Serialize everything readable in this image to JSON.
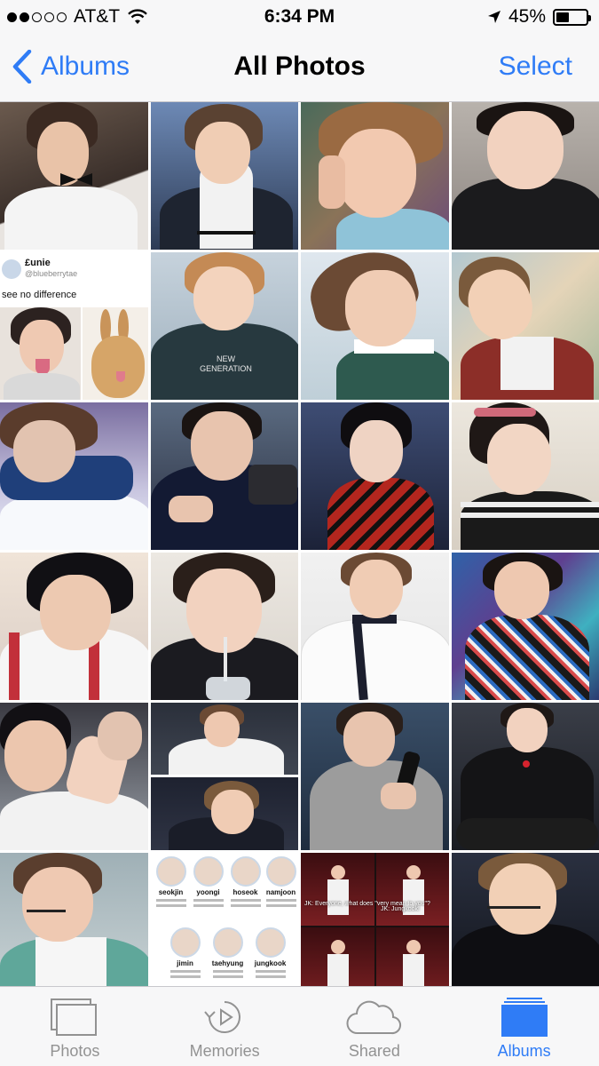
{
  "status_bar": {
    "carrier": "AT&T",
    "time": "6:34 PM",
    "battery_percent": "45%",
    "battery_level": 0.45,
    "signal_bars_filled": 2,
    "signal_bars_total": 5
  },
  "nav": {
    "back_label": "Albums",
    "title": "All Photos",
    "action_label": "Select"
  },
  "photos": [
    {
      "subject": "portrait-bowtie"
    },
    {
      "subject": "portrait-turtleneck"
    },
    {
      "subject": "selfie-closeup"
    },
    {
      "subject": "portrait-smile"
    },
    {
      "subject": "tweet-meme",
      "tweet_name": "£unie",
      "tweet_handle": "@blueberrytae",
      "tweet_text": "see no difference"
    },
    {
      "subject": "portrait-sweater",
      "shirt_text_1": "NEW",
      "shirt_text_2": "GENERATION"
    },
    {
      "subject": "portrait-profile"
    },
    {
      "subject": "portrait-laughing"
    },
    {
      "subject": "portrait-blue"
    },
    {
      "subject": "portrait-camera"
    },
    {
      "subject": "stage-red-jacket"
    },
    {
      "subject": "portrait-headband"
    },
    {
      "subject": "portrait-pink"
    },
    {
      "subject": "portrait-drink"
    },
    {
      "subject": "portrait-choker"
    },
    {
      "subject": "portrait-graffiti"
    },
    {
      "subject": "portrait-wave"
    },
    {
      "subject": "collage-two"
    },
    {
      "subject": "stage-microphone"
    },
    {
      "subject": "portrait-leather"
    },
    {
      "subject": "portrait-headset"
    },
    {
      "subject": "member-chart",
      "names": [
        "seokjin",
        "yoongi",
        "hoseok",
        "namjoon",
        "jimin",
        "taehyung",
        "jungkook"
      ]
    },
    {
      "subject": "stage-collage",
      "caption_1": "JK: Everyone, what does \"very mean to you\"?",
      "caption_2": "JK: Jungkook!"
    },
    {
      "subject": "portrait-dark-headset"
    }
  ],
  "tabs": [
    {
      "label": "Photos",
      "icon": "photos-icon",
      "active": false
    },
    {
      "label": "Memories",
      "icon": "memories-icon",
      "active": false
    },
    {
      "label": "Shared",
      "icon": "cloud-icon",
      "active": false
    },
    {
      "label": "Albums",
      "icon": "albums-icon",
      "active": true
    }
  ],
  "colors": {
    "accent": "#2f7cf6",
    "inactive": "#929292",
    "bar_background": "#f7f7f8"
  }
}
